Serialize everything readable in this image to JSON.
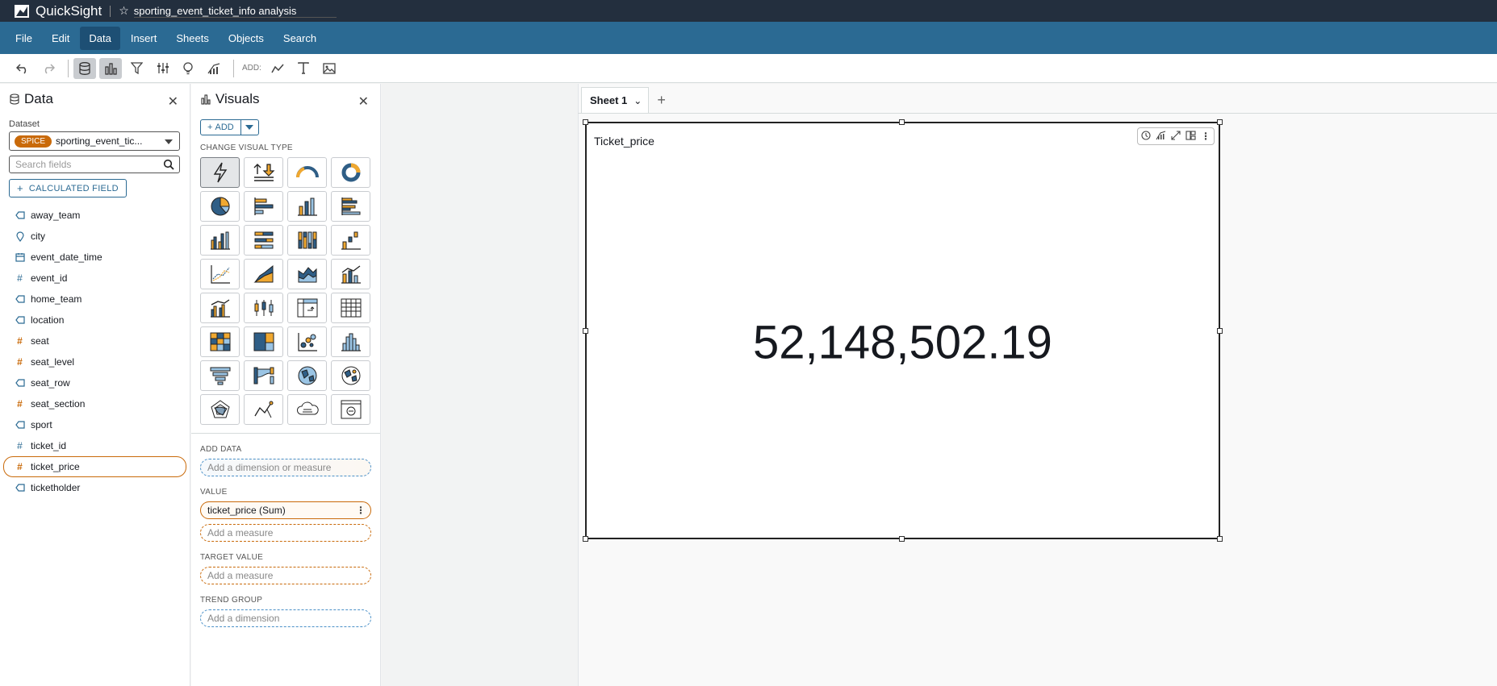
{
  "app": {
    "brand": "QuickSight",
    "analysis_title": "sporting_event_ticket_info analysis"
  },
  "menu": [
    "File",
    "Edit",
    "Data",
    "Insert",
    "Sheets",
    "Objects",
    "Search"
  ],
  "menu_active": "Data",
  "toolbar": {
    "add_label": "ADD:"
  },
  "data_panel": {
    "title": "Data",
    "dataset_label": "Dataset",
    "dataset_badge": "SPICE",
    "dataset_name": "sporting_event_tic...",
    "search_placeholder": "Search fields",
    "calc_button": "CALCULATED FIELD",
    "fields": [
      {
        "name": "away_team",
        "type": "dimension",
        "icon": "tag-icon"
      },
      {
        "name": "city",
        "type": "dimension",
        "icon": "location-pin-icon"
      },
      {
        "name": "event_date_time",
        "type": "dimension",
        "icon": "calendar-icon"
      },
      {
        "name": "event_id",
        "type": "dimension",
        "icon": "hash-icon"
      },
      {
        "name": "home_team",
        "type": "dimension",
        "icon": "tag-icon"
      },
      {
        "name": "location",
        "type": "dimension",
        "icon": "tag-icon"
      },
      {
        "name": "seat",
        "type": "measure",
        "icon": "hash-icon"
      },
      {
        "name": "seat_level",
        "type": "measure",
        "icon": "hash-icon"
      },
      {
        "name": "seat_row",
        "type": "dimension",
        "icon": "tag-icon"
      },
      {
        "name": "seat_section",
        "type": "measure",
        "icon": "hash-icon"
      },
      {
        "name": "sport",
        "type": "dimension",
        "icon": "tag-icon"
      },
      {
        "name": "ticket_id",
        "type": "dimension",
        "icon": "hash-icon"
      },
      {
        "name": "ticket_price",
        "type": "measure",
        "icon": "hash-icon",
        "selected": true
      },
      {
        "name": "ticketholder",
        "type": "dimension",
        "icon": "tag-icon"
      }
    ]
  },
  "visuals_panel": {
    "title": "Visuals",
    "add_button": "ADD",
    "change_type_label": "CHANGE VISUAL TYPE",
    "add_data_label": "ADD DATA",
    "add_data_placeholder": "Add a dimension or measure",
    "value_label": "VALUE",
    "value_field": "ticket_price (Sum)",
    "value_placeholder": "Add a measure",
    "target_label": "TARGET VALUE",
    "target_placeholder": "Add a measure",
    "trend_label": "TREND GROUP",
    "trend_placeholder": "Add a dimension"
  },
  "sheet": {
    "tab": "Sheet 1"
  },
  "visual": {
    "title": "Ticket_price",
    "kpi_value": "52,148,502.19"
  },
  "colors": {
    "menubar": "#2b6a93",
    "topbar": "#232f3e",
    "measure": "#c96a0a",
    "dimension": "#2b6a93"
  }
}
